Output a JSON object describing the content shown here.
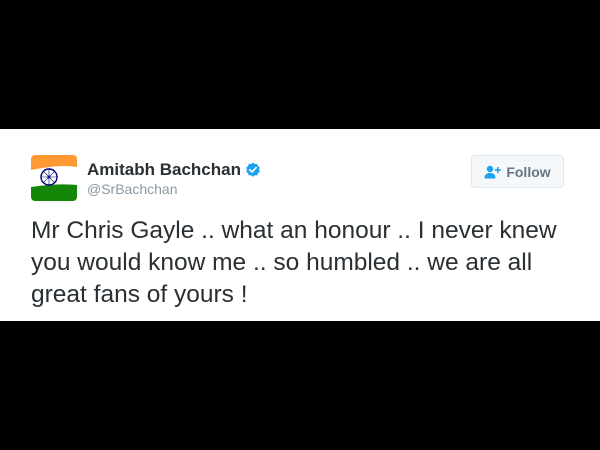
{
  "tweet": {
    "author_name": "Amitabh Bachchan",
    "author_handle": "@SrBachchan",
    "text": "Mr Chris Gayle .. what an honour .. I never knew you would know me .. so humbled .. we are all great fans of yours !"
  },
  "follow_button": {
    "label": "Follow"
  },
  "icons": {
    "verified": "verified-badge-icon",
    "follow": "add-user-icon",
    "avatar_emblem": "ashoka-chakra-icon"
  },
  "colors": {
    "card_background": "#ffffff",
    "letterbox": "#000000",
    "verified_blue": "#1da1f2",
    "saffron": "#ff9933",
    "green": "#138808",
    "chakra_navy": "#000080"
  }
}
